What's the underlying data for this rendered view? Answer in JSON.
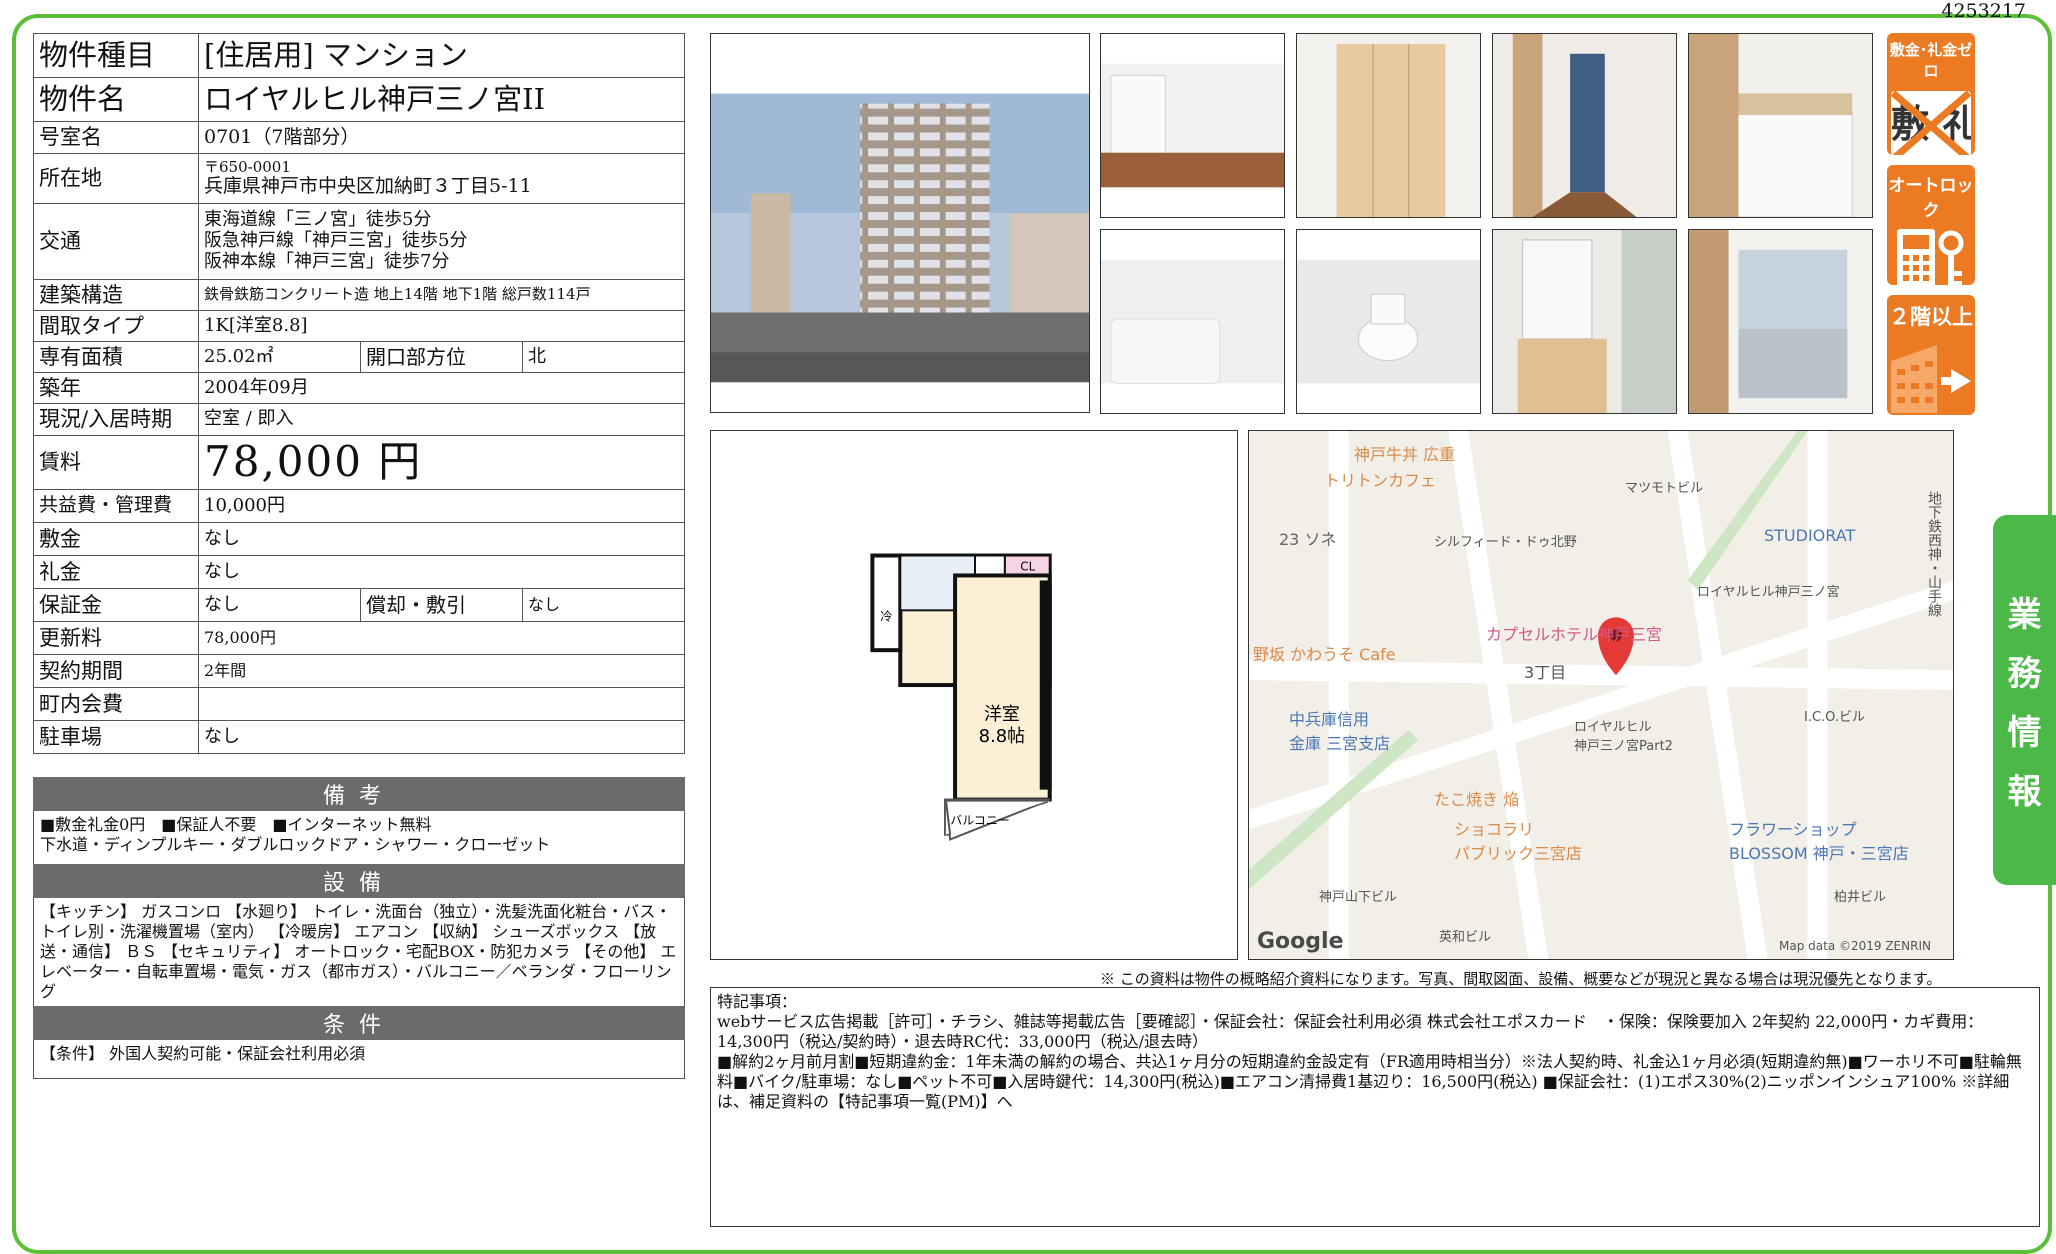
{
  "doc_id": "4253217",
  "property": {
    "type_label": "物件種目",
    "type_value": "[住居用] マンション",
    "name_label": "物件名",
    "name_value": "ロイヤルヒル神戸三ノ宮II",
    "room_label": "号室名",
    "room_value": "0701（7階部分）",
    "address_label": "所在地",
    "postal": "〒650-0001",
    "address": "兵庫県神戸市中央区加納町３丁目5-11",
    "access_label": "交通",
    "access": [
      "東海道線「三ノ宮」徒歩5分",
      "阪急神戸線「神戸三宮」徒歩5分",
      "阪神本線「神戸三宮」徒歩7分"
    ],
    "structure_label": "建築構造",
    "structure_value": "鉄骨鉄筋コンクリート造 地上14階 地下1階 総戸数114戸",
    "layout_label": "間取タイプ",
    "layout_value": "1K[洋室8.8]",
    "area_label": "専有面積",
    "area_value": "25.02㎡",
    "direction_label": "開口部方位",
    "direction_value": "北",
    "built_label": "築年",
    "built_value": "2004年09月",
    "status_label": "現況/入居時期",
    "status_value": "空室 / 即入",
    "rent_label": "賃料",
    "rent_value": "78,000 円",
    "fee_label": "共益費・管理費",
    "fee_value": "10,000円",
    "deposit_label": "敷金",
    "deposit_value": "なし",
    "key_label": "礼金",
    "key_value": "なし",
    "guarantee_label": "保証金",
    "guarantee_value": "なし",
    "amort_label": "償却・敷引",
    "amort_value": "なし",
    "renewal_label": "更新料",
    "renewal_value": "78,000円",
    "term_label": "契約期間",
    "term_value": "2年間",
    "town_label": "町内会費",
    "town_value": "",
    "parking_label": "駐車場",
    "parking_value": "なし"
  },
  "sections": {
    "remarks_title": "備考",
    "remarks_lines": [
      "■敷金礼金0円　■保証人不要　■インターネット無料",
      "下水道・ディンプルキー・ダブルロックドア・シャワー・クローゼット"
    ],
    "equip_title": "設備",
    "equip_text": "【キッチン】 ガスコンロ 【水廻り】 トイレ・洗面台（独立）・洗髪洗面化粧台・バス・トイレ別・洗濯機置場（室内） 【冷暖房】 エアコン 【収納】 シューズボックス 【放送・通信】 ＢＳ 【セキュリティ】 オートロック・宅配BOX・防犯カメラ 【その他】 エレベーター・自転車置場・電気・ガス（都市ガス）・バルコニー／ベランダ・フローリング",
    "cond_title": "条件",
    "cond_text": "【条件】 外国人契約可能・保証会社利用必須"
  },
  "badges": {
    "b1": "敷金･礼金ゼロ",
    "b1_glyph": "敷 礼",
    "b2": "オートロック",
    "b3": "２階以上"
  },
  "side_tab": [
    "業",
    "務",
    "情",
    "報"
  ],
  "floorplan": {
    "room": "洋室",
    "size": "8.8帖",
    "balcony": "バルコニー",
    "cl": "CL",
    "ref": "冷"
  },
  "map": {
    "labels": [
      "神戸牛丼 広重",
      "トリトンカフェ",
      "23 ソネ",
      "シルフィード・ドゥ北野",
      "STUDIORAT",
      "マツモトビル",
      "ロイヤルヒル神戸三ノ宮",
      "カプセルホテル神戸三宮",
      "野坂 かわうそ Cafe",
      "3丁目",
      "ロイヤルヒル\n神戸三ノ宮Part2",
      "中兵庫信用\n金庫 三宮支店",
      "たこ焼き 焔",
      "ショコラリ\nパブリック三宮店",
      "フラワーショップ\nBLOSSOM 神戸・三宮店",
      "I.C.O.ビル",
      "神戸山下ビル",
      "英和ビル",
      "柏井ビル",
      "地下鉄西神・山手線"
    ],
    "google": "Google",
    "credit": "Map data ©2019 ZENRIN"
  },
  "disclaimer": "※ この資料は物件の概略紹介資料になります。写真、間取図面、設備、概要などが現況と異なる場合は現況優先となります。",
  "special": {
    "title": "特記事項：",
    "lines": [
      "webサービス広告掲載［許可］・チラシ、雑誌等掲載広告［要確認］・保証会社：保証会社利用必須 株式会社エポスカード　・保険：保険要加入 2年契約 22,000円・カギ費用：14,300円（税込/契約時）・退去時RC代：33,000円（税込/退去時）",
      "■解約2ヶ月前月割■短期違約金：1年未満の解約の場合、共込1ヶ月分の短期違約金設定有（FR適用時相当分）※法人契約時、礼金込1ヶ月必須(短期違約無)■ワーホリ不可■駐輪無料■バイク/駐車場：なし■ペット不可■入居時鍵代：14,300円(税込)■エアコン清掃費1基辺り：16,500円(税込) ■保証会社：(1)エポス30%(2)ニッポンインシュア100% ※詳細は、補足資料の【特記事項一覧(PM)】へ"
    ]
  }
}
